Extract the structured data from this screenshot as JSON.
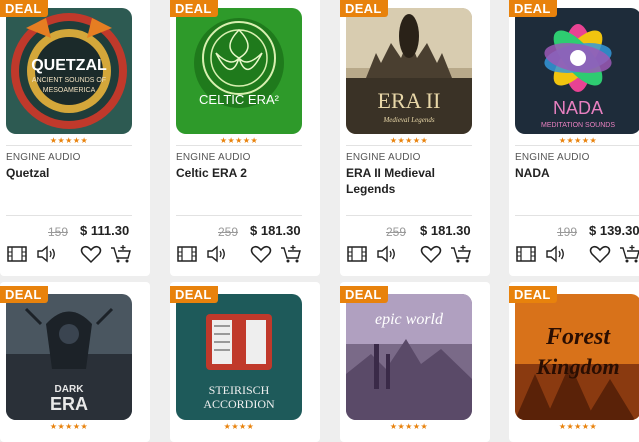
{
  "deal_label": "DEAL",
  "products": [
    {
      "brand": "ENGINE AUDIO",
      "title": "Quetzal",
      "old_price": "159",
      "price": "$ 111.30",
      "stars": "★★★★★",
      "art_text": [
        "QUETZAL",
        "ANCIENT SOUNDS OF",
        "MESOAMERICA"
      ]
    },
    {
      "brand": "ENGINE AUDIO",
      "title": "Celtic ERA 2",
      "old_price": "259",
      "price": "$ 181.30",
      "stars": "★★★★★",
      "art_text": [
        "CELTIC ERA²"
      ]
    },
    {
      "brand": "ENGINE AUDIO",
      "title": "ERA II Medieval Legends",
      "old_price": "259",
      "price": "$ 181.30",
      "stars": "★★★★★",
      "art_text": [
        "ERA II",
        "Medieval Legends"
      ]
    },
    {
      "brand": "ENGINE AUDIO",
      "title": "NADA",
      "old_price": "199",
      "price": "$ 139.30",
      "stars": "★★★★★",
      "art_text": [
        "NADA",
        "MEDITATION SOUNDS"
      ]
    },
    {
      "stars": "★★★★★",
      "art_text": [
        "DARK",
        "ERA"
      ]
    },
    {
      "stars": "★★★★",
      "art_text": [
        "STEIRISCH",
        "ACCORDION"
      ]
    },
    {
      "stars": "★★★★★",
      "art_text": [
        "epic world"
      ]
    },
    {
      "stars": "★★★★★",
      "art_text": [
        "Forest",
        "Kingdom"
      ]
    }
  ],
  "icons": [
    "video-icon",
    "speaker-icon",
    "heart-icon",
    "add-to-cart-icon"
  ],
  "colors": {
    "deal": "#e8820c",
    "price": "#222222",
    "old_price": "#999999",
    "icon": "#222222"
  }
}
